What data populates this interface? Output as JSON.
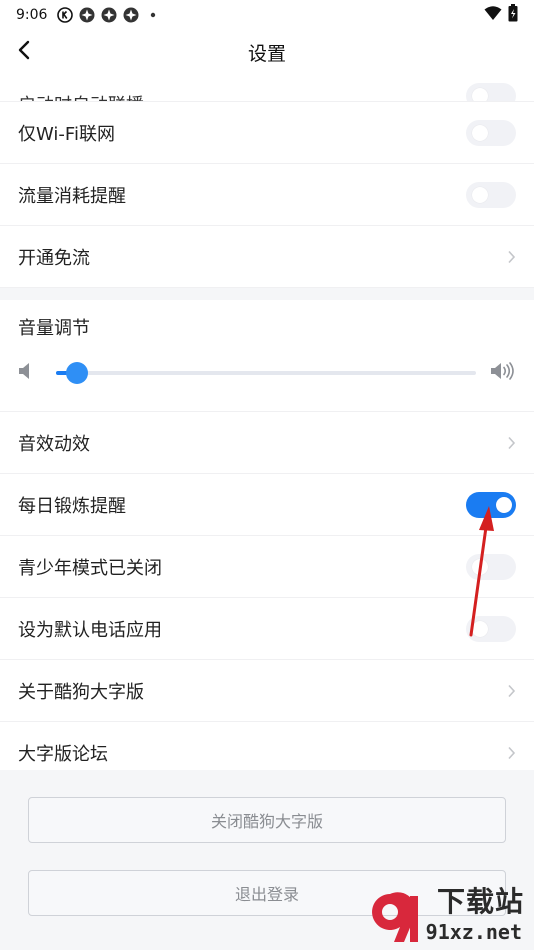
{
  "status_bar": {
    "time": "9:06",
    "icons": [
      "k-circle-icon",
      "pinwheel-icon",
      "pinwheel-icon",
      "pinwheel-icon",
      "dot-icon"
    ],
    "right_icons": [
      "wifi-icon",
      "battery-icon"
    ]
  },
  "header": {
    "title": "设置",
    "back_icon": "chevron-left-icon"
  },
  "list": {
    "clipped_row": {
      "label": "启动时自动联播",
      "toggle_on": false
    },
    "rows_top": [
      {
        "label": "仅Wi-Fi联网",
        "control": "toggle",
        "on": false
      },
      {
        "label": "流量消耗提醒",
        "control": "toggle",
        "on": false
      },
      {
        "label": "开通免流",
        "control": "chevron"
      }
    ],
    "volume": {
      "label": "音量调节",
      "level": 0.05,
      "left_icon": "speaker-low-icon",
      "right_icon": "speaker-high-icon"
    },
    "rows_bottom": [
      {
        "label": "音效动效",
        "control": "chevron"
      },
      {
        "label": "每日锻炼提醒",
        "control": "toggle",
        "on": true
      },
      {
        "label": "青少年模式已关闭",
        "control": "toggle",
        "on": false
      },
      {
        "label": "设为默认电话应用",
        "control": "toggle",
        "on": false
      },
      {
        "label": "关于酷狗大字版",
        "control": "chevron"
      },
      {
        "label": "大字版论坛",
        "control": "chevron"
      }
    ]
  },
  "buttons": {
    "close_label": "关闭酷狗大字版",
    "logout_label": "退出登录"
  },
  "watermark": {
    "title": "下载站",
    "subtitle": "91xz.net"
  },
  "colors": {
    "accent": "#1a7cf2",
    "toggle_off": "#f1f2f6",
    "annotation_arrow": "#d42020"
  }
}
